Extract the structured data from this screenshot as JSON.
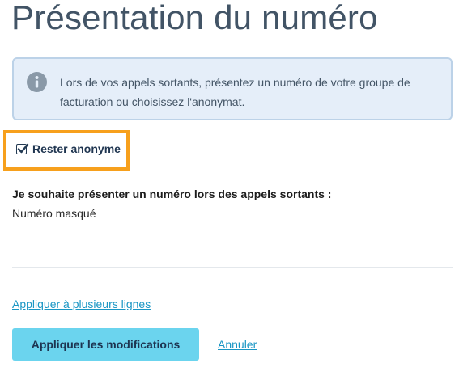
{
  "page": {
    "title": "Présentation du numéro"
  },
  "info": {
    "icon": "info-circle-icon",
    "text": "Lors de vos appels sortants, présentez un numéro de votre groupe de facturation ou choisissez l'anonymat."
  },
  "anonymous": {
    "label": "Rester anonyme",
    "checked": true,
    "highlight_color": "#f7a01c"
  },
  "presentation": {
    "label": "Je souhaite présenter un numéro lors des appels sortants :",
    "value": "Numéro masqué"
  },
  "actions": {
    "apply_multiple_label": "Appliquer à plusieurs lignes",
    "apply_label": "Appliquer les modifications",
    "cancel_label": "Annuler"
  },
  "colors": {
    "accent": "#6bd4ee",
    "link": "#1a96c4",
    "info_background": "#e5eef9"
  }
}
